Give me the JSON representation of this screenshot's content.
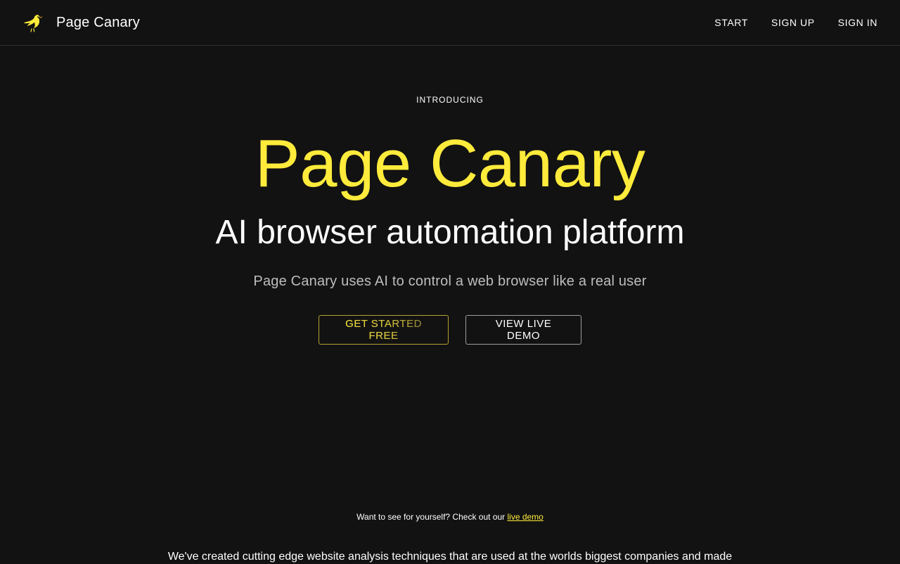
{
  "header": {
    "brand_name": "Page Canary",
    "logo_icon": "canary-bird-icon",
    "nav": {
      "start": "START",
      "sign_up": "SIGN UP",
      "sign_in": "SIGN IN"
    }
  },
  "hero": {
    "overline": "INTRODUCING",
    "title": "Page Canary",
    "subtitle": "AI browser automation platform",
    "description": "Page Canary uses AI to control a web browser like a real user",
    "primary_button": "GET STARTED FREE",
    "secondary_button": "VIEW LIVE DEMO"
  },
  "demo_note": {
    "text": "Want to see for yourself? Check out our",
    "link": "live demo"
  },
  "body_text": "We've created cutting edge website analysis techniques that are used at the worlds biggest companies and made",
  "colors": {
    "background": "#121212",
    "accent": "#ffeb3b",
    "text": "#ffffff",
    "muted_text": "#bdbdbd",
    "divider": "#2e2e2e"
  }
}
